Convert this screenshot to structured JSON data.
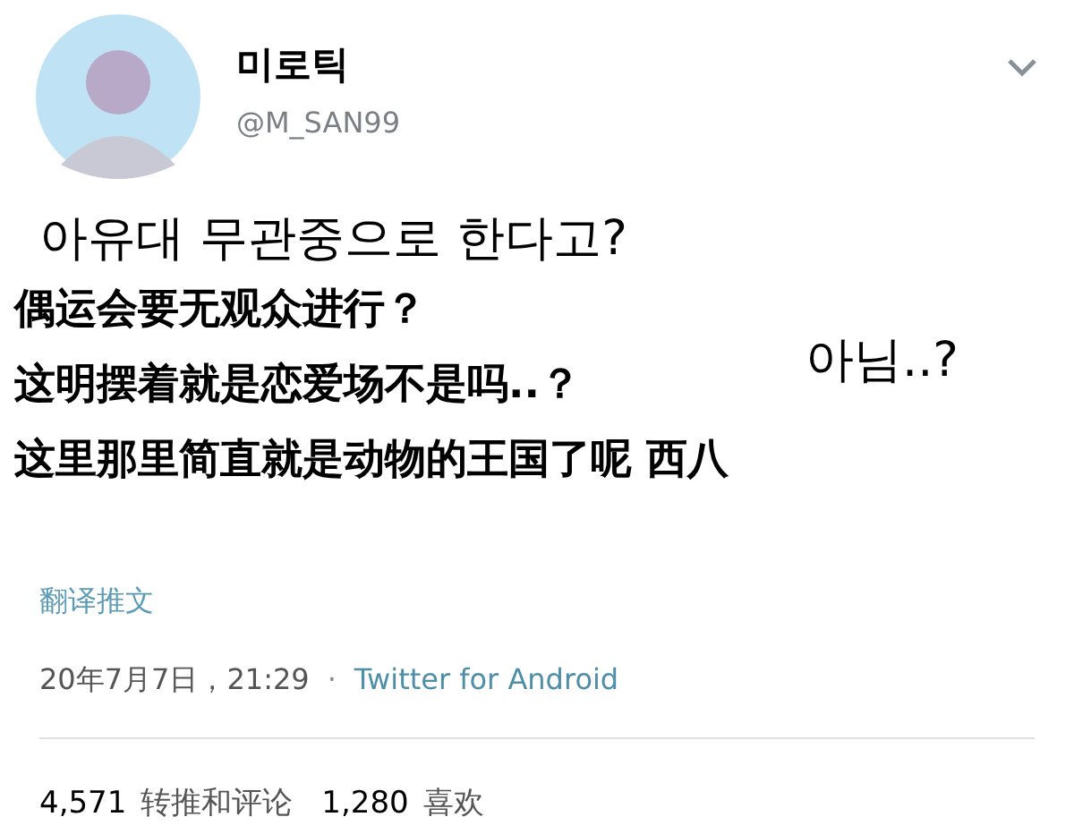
{
  "tweet": {
    "display_name": "미로틱",
    "handle": "@M_SAN99",
    "text_lines": [
      "아유대 무관중으로 한다고?",
      "아님..?"
    ],
    "captions": [
      "偶运会要无观众进行？",
      "这明摆着就是恋爱场不是吗..？",
      "这里那里简直就是动物的王国了呢 西八"
    ],
    "translate_link": "翻译推文",
    "timestamp": "20年7月7日，21:29",
    "separator": "·",
    "source": "Twitter for Android",
    "stats": [
      {
        "count": "4,571",
        "label": "转推和评论"
      },
      {
        "count": "1,280",
        "label": "喜欢"
      }
    ]
  }
}
